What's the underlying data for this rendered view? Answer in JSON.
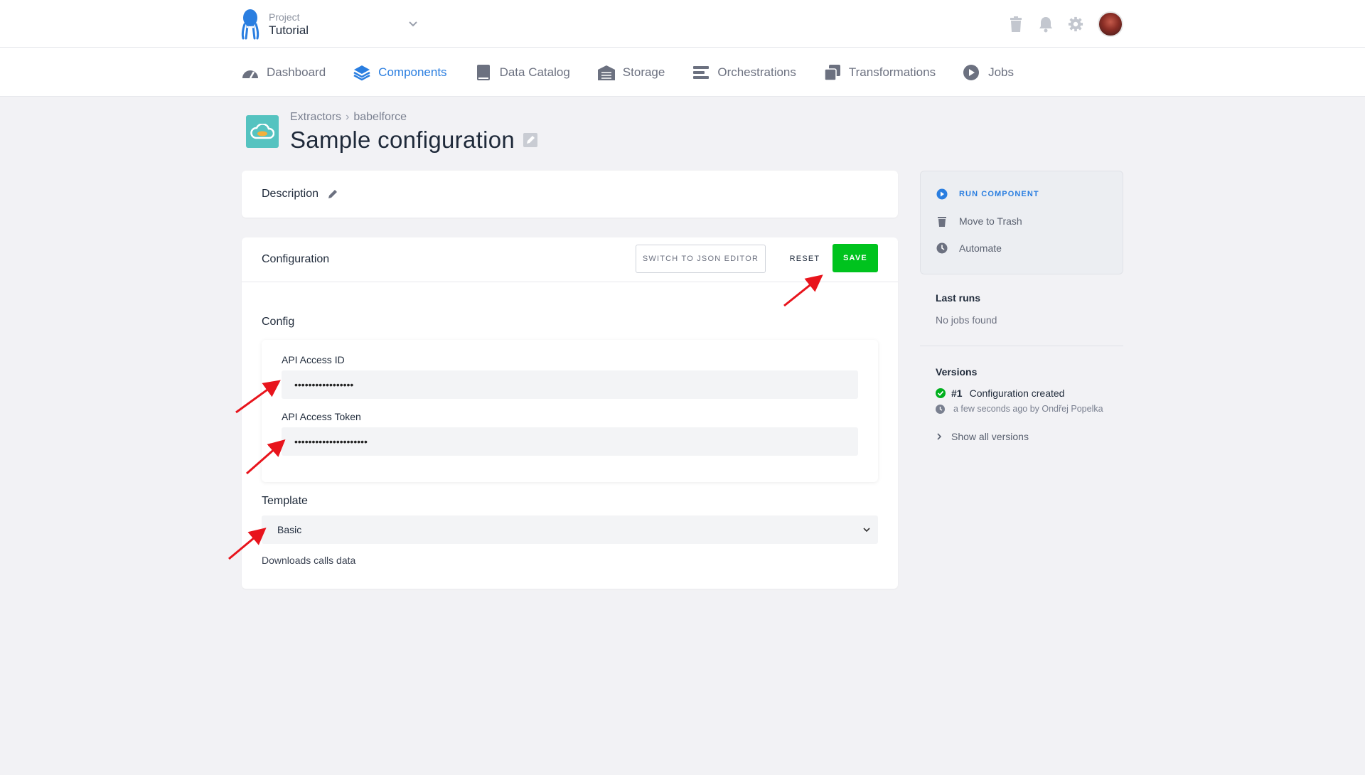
{
  "project": {
    "label": "Project",
    "name": "Tutorial"
  },
  "nav": [
    {
      "label": "Dashboard",
      "icon": "dashboard-icon"
    },
    {
      "label": "Components",
      "icon": "layers-icon",
      "active": true
    },
    {
      "label": "Data Catalog",
      "icon": "book-icon"
    },
    {
      "label": "Storage",
      "icon": "warehouse-icon"
    },
    {
      "label": "Orchestrations",
      "icon": "bars-icon"
    },
    {
      "label": "Transformations",
      "icon": "copy-icon"
    },
    {
      "label": "Jobs",
      "icon": "play-icon"
    }
  ],
  "breadcrumb": {
    "parent": "Extractors",
    "separator": "›",
    "current": "babelforce"
  },
  "page": {
    "title": "Sample configuration"
  },
  "description": {
    "label": "Description"
  },
  "configuration": {
    "title": "Configuration",
    "json_button": "SWITCH TO JSON EDITOR",
    "reset_button": "RESET",
    "save_button": "SAVE",
    "config_label": "Config",
    "api_id_label": "API Access ID",
    "api_id_value": "•••••••••••••••••",
    "api_token_label": "API Access Token",
    "api_token_value": "•••••••••••••••••••••",
    "template_label": "Template",
    "template_value": "Basic",
    "template_help": "Downloads calls data"
  },
  "sidebar": {
    "run": "RUN COMPONENT",
    "trash": "Move to Trash",
    "automate": "Automate",
    "last_runs_title": "Last runs",
    "last_runs_empty": "No jobs found",
    "versions_title": "Versions",
    "version_number": "#1",
    "version_message": "Configuration created",
    "version_meta": "a few seconds ago by Ondřej Popelka",
    "show_all": "Show all versions"
  },
  "colors": {
    "accent": "#2a7ee0",
    "save": "#00c31e",
    "annotation": "#e8141c"
  }
}
